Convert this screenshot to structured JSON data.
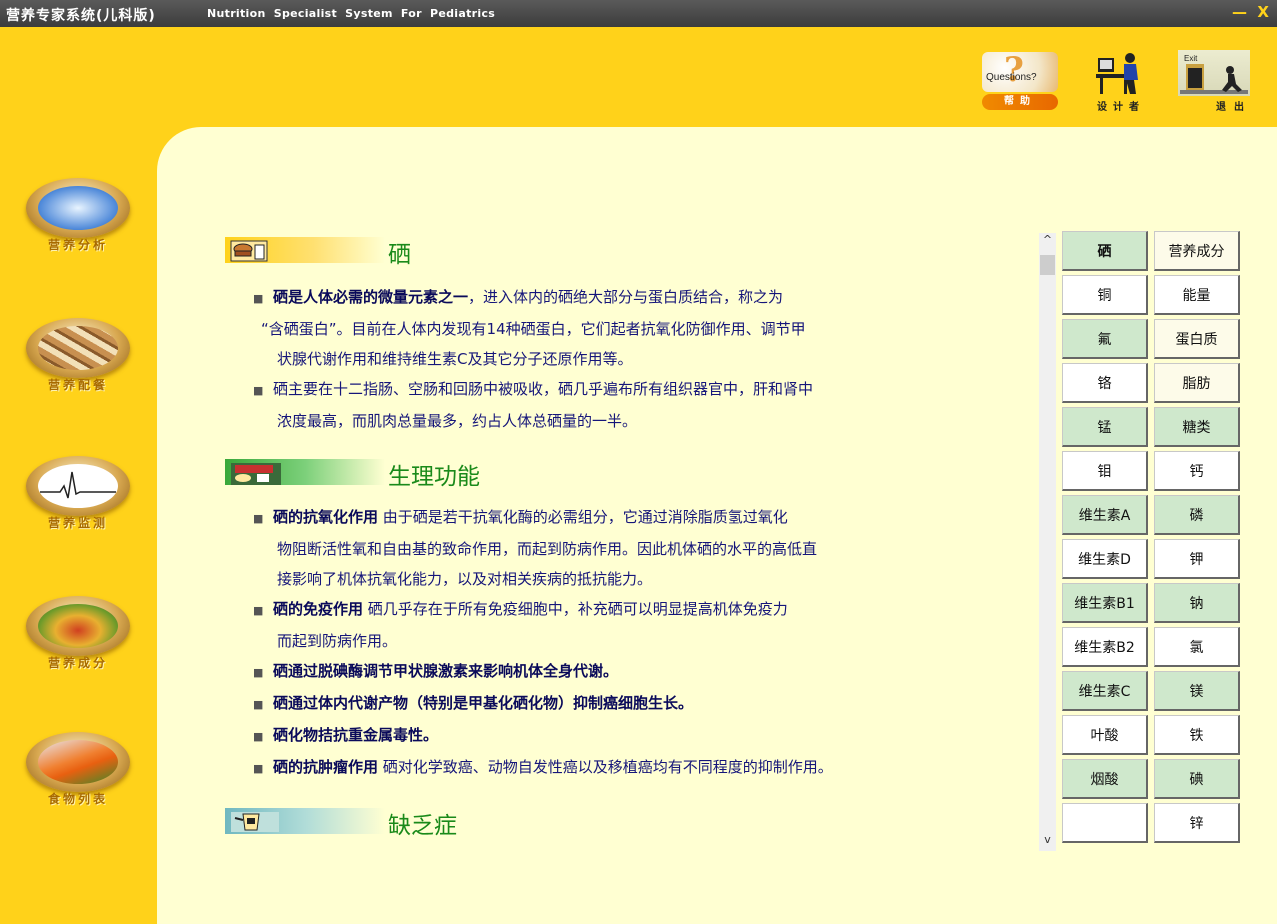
{
  "window": {
    "title": "营养专家系统(儿科版)",
    "subtitle": "Nutrition Specialist System For Pediatrics",
    "minimize": "—",
    "close": "X"
  },
  "top_buttons": {
    "help": {
      "top_text": "Questions?",
      "label": "帮助"
    },
    "designer": {
      "label": "设计者"
    },
    "exit": {
      "top_text": "Exit",
      "label": "退出"
    }
  },
  "nav": [
    {
      "label": "营养分析",
      "icon": "microscope-chef-icon"
    },
    {
      "label": "营养配餐",
      "icon": "meal-plate-icon"
    },
    {
      "label": "营养监测",
      "icon": "heartbeat-monitor-icon"
    },
    {
      "label": "营养成分",
      "icon": "food-basket-icon"
    },
    {
      "label": "食物列表",
      "icon": "vegetables-icon"
    }
  ],
  "sections": [
    {
      "title": "硒",
      "lines": [
        {
          "bullet": true,
          "bold": "硒是人体必需的微量元素之一",
          "text": "，进入体内的硒绝大部分与蛋白质结合，称之为"
        },
        {
          "bullet": false,
          "bold": "",
          "text": "“含硒蛋白”。目前在人体内发现有14种硒蛋白，它们起者抗氧化防御作用、调节甲"
        },
        {
          "bullet": false,
          "bold": "",
          "text": "状腺代谢作用和维持维生素C及其它分子还原作用等。"
        },
        {
          "bullet": true,
          "bold": "",
          "text": "硒主要在十二指肠、空肠和回肠中被吸收，硒几乎遍布所有组织器官中，肝和肾中"
        },
        {
          "bullet": false,
          "bold": "",
          "text": "浓度最高，而肌肉总量最多，约占人体总硒量的一半。"
        }
      ]
    },
    {
      "title": "生理功能",
      "lines": [
        {
          "bullet": true,
          "bold": "硒的抗氧化作用",
          "text": "   由于硒是若干抗氧化酶的必需组分，它通过消除脂质氢过氧化"
        },
        {
          "bullet": false,
          "bold": "",
          "text": "物阻断活性氧和自由基的致命作用，而起到防病作用。因此机体硒的水平的高低直"
        },
        {
          "bullet": false,
          "bold": "",
          "text": "接影响了机体抗氧化能力，以及对相关疾病的抵抗能力。"
        },
        {
          "bullet": true,
          "bold": "硒的免疫作用",
          "text": "   硒几乎存在于所有免疫细胞中，补充硒可以明显提高机体免疫力"
        },
        {
          "bullet": false,
          "bold": "",
          "text": "而起到防病作用。"
        },
        {
          "bullet": true,
          "bold": "硒通过脱碘酶调节甲状腺激素来影响机体全身代谢。",
          "text": ""
        },
        {
          "bullet": true,
          "bold": "硒通过体内代谢产物（特别是甲基化硒化物）抑制癌细胞生长。",
          "text": ""
        },
        {
          "bullet": true,
          "bold": "硒化物拮抗重金属毒性。",
          "text": ""
        },
        {
          "bullet": true,
          "bold": "硒的抗肿瘤作用",
          "text": "   硒对化学致癌、动物自发性癌以及移植癌均有不同程度的抑制作用。"
        }
      ]
    },
    {
      "title": "缺乏症",
      "lines": []
    }
  ],
  "nutrient_table": {
    "left": [
      "硒",
      "铜",
      "氟",
      "铬",
      "锰",
      "钼",
      "维生素A",
      "维生素D",
      "维生素B1",
      "维生素B2",
      "维生素C",
      "叶酸",
      "烟酸",
      ""
    ],
    "right": [
      "营养成分",
      "能量",
      "蛋白质",
      "脂肪",
      "糖类",
      "钙",
      "磷",
      "钾",
      "钠",
      "氯",
      "镁",
      "铁",
      "碘",
      "锌"
    ],
    "left_styles": [
      "green bold",
      "white",
      "green",
      "white",
      "green",
      "white",
      "green",
      "white",
      "green",
      "white",
      "green",
      "white",
      "green",
      "white"
    ],
    "right_styles": [
      "cream",
      "white",
      "cream",
      "cream",
      "green",
      "white",
      "green",
      "white",
      "green",
      "white",
      "green",
      "white",
      "green",
      "white"
    ]
  },
  "scrollbar": {
    "up": "^",
    "down": "v"
  },
  "colors": {
    "accent_yellow": "#ffd21a",
    "panel_cream": "#ffffd2",
    "heading_green": "#1a8a1a",
    "text_navy": "#16167a",
    "cell_green": "#cfe8cc"
  }
}
